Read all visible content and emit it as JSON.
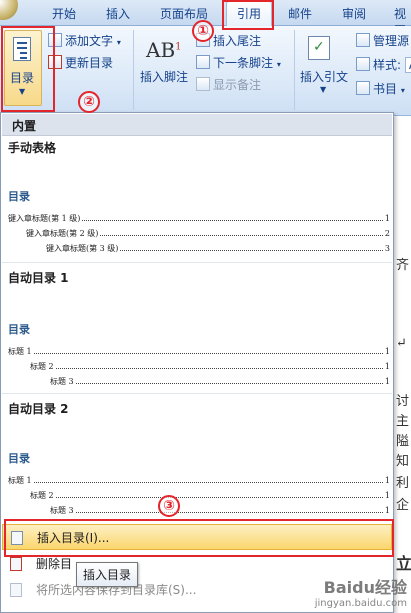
{
  "tabs": [
    "开始",
    "插入",
    "页面布局",
    "引用",
    "邮件",
    "审阅",
    "视图"
  ],
  "ribbon": {
    "toc_button": "目录",
    "add_text": "添加文字",
    "update_toc": "更新目录",
    "insert_footnote": "插入脚注",
    "insert_endnote": "插入尾注",
    "next_footnote": "下一条脚注",
    "show_notes": "显示备注",
    "insert_citation": "插入引文",
    "manage_sources": "管理源",
    "style_label": "样式:",
    "style_value": "AP",
    "bibliography": "书目"
  },
  "dropdown": {
    "section_builtin": "内置",
    "manual_table": {
      "title": "手动表格",
      "preview_title": "目录",
      "lines": [
        {
          "label": "键入章标题(第 1 级)",
          "page": "1"
        },
        {
          "label": "键入章标题(第 2 级)",
          "page": "2"
        },
        {
          "label": "键入章标题(第 3 级)",
          "page": "3"
        }
      ]
    },
    "auto_toc1": {
      "title": "自动目录 1",
      "preview_title": "目录",
      "lines": [
        {
          "label": "标题 1",
          "page": "1"
        },
        {
          "label": "标题 2",
          "page": "1"
        },
        {
          "label": "标题 3",
          "page": "1"
        }
      ]
    },
    "auto_toc2": {
      "title": "自动目录 2",
      "preview_title": "目录",
      "lines": [
        {
          "label": "标题 1",
          "page": "1"
        },
        {
          "label": "标题 2",
          "page": "1"
        },
        {
          "label": "标题 3",
          "page": "1"
        }
      ]
    },
    "insert_toc": "插入目录(I)...",
    "delete_toc": "删除目",
    "save_selection": "将所选内容保存到目录库(S)..."
  },
  "tooltip": "插入目录",
  "annotations": [
    "①",
    "②",
    "③"
  ],
  "doc_fragments": [
    "齐",
    "↵",
    "讨",
    "主",
    "隘",
    "知",
    "利",
    "企",
    "立"
  ],
  "watermark": {
    "brand": "Baidu经验",
    "url": "jingyan.baidu.com"
  }
}
